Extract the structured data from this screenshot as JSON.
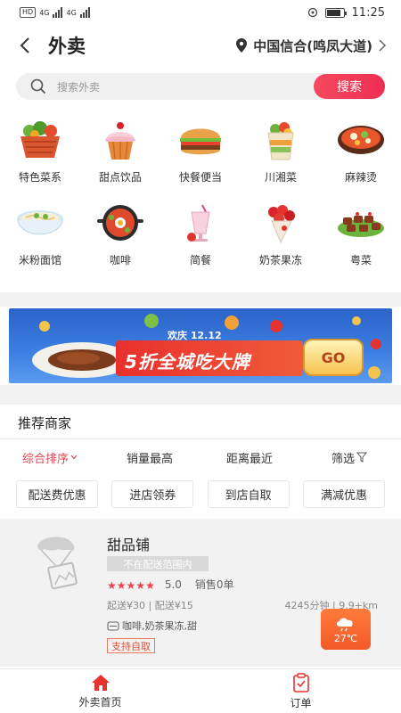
{
  "status_bar": {
    "hd": "HD",
    "signal_1": "4G",
    "signal_2": "4G",
    "time": "11:25",
    "battery_level": 0.85
  },
  "header": {
    "title": "外卖",
    "location": "中国信合(鸣凤大道)"
  },
  "search": {
    "placeholder": "搜索外卖",
    "button_label": "搜索"
  },
  "categories": [
    {
      "label": "特色菜系",
      "icon": "vegetable-basket-icon"
    },
    {
      "label": "甜点饮品",
      "icon": "cupcake-icon"
    },
    {
      "label": "快餐便当",
      "icon": "burger-icon"
    },
    {
      "label": "川湘菜",
      "icon": "salad-cup-icon"
    },
    {
      "label": "麻辣烫",
      "icon": "hotpot-bowl-icon"
    },
    {
      "label": "米粉面馆",
      "icon": "noodle-bowl-icon"
    },
    {
      "label": "咖啡",
      "icon": "bibimbap-pot-icon"
    },
    {
      "label": "简餐",
      "icon": "smoothie-glass-icon"
    },
    {
      "label": "奶茶果冻",
      "icon": "flower-bouquet-icon"
    },
    {
      "label": "粤菜",
      "icon": "skewers-icon"
    }
  ],
  "banner": {
    "subtitle": "欢庆 12.12",
    "headline": "5折全城吃大牌",
    "go_label": "GO"
  },
  "recommend": {
    "title": "推荐商家"
  },
  "sort_options": [
    {
      "label": "综合排序",
      "active": true
    },
    {
      "label": "销量最高",
      "active": false
    },
    {
      "label": "距离最近",
      "active": false
    },
    {
      "label": "筛选",
      "active": false
    }
  ],
  "filters": [
    "配送费优惠",
    "进店领券",
    "到店自取",
    "满减优惠"
  ],
  "shop": {
    "name": "甜品铺",
    "status": "不在配送范围内",
    "rating": 5.0,
    "rating_text": "5.0",
    "sales": "销售0单",
    "delivery": "起送¥30 | 配送¥15",
    "time_distance": "4245分钟 | 9.9+km",
    "categories": "咖啡,奶茶果冻,甜",
    "tag": "支持自取"
  },
  "weather": {
    "temp": "27℃",
    "icon": "rain-cloud-icon"
  },
  "tabs": [
    {
      "label": "外卖首页",
      "icon": "home-icon"
    },
    {
      "label": "订单",
      "icon": "order-clipboard-icon"
    }
  ],
  "colors": {
    "accent": "#e4434e",
    "search_button": "#ee2e53"
  }
}
